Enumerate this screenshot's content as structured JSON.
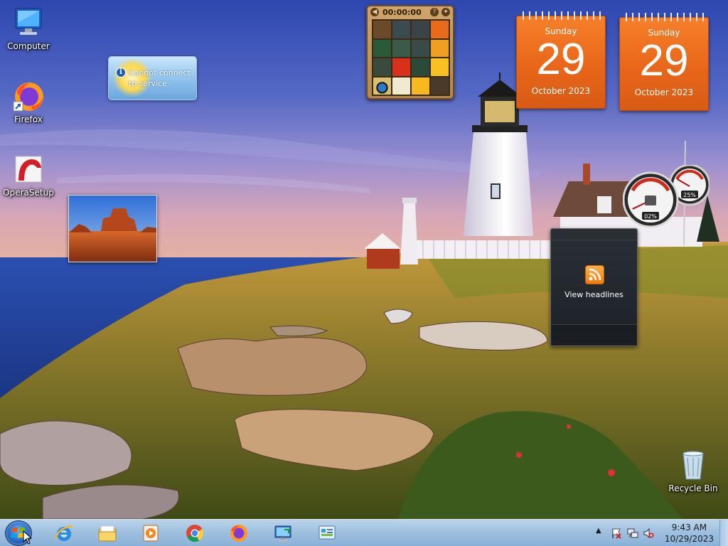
{
  "desktop": {
    "icons": [
      {
        "label": "Computer",
        "icon": "computer-icon"
      },
      {
        "label": "Firefox",
        "icon": "firefox-icon"
      },
      {
        "label": "OperaSetup",
        "icon": "opera-setup-icon"
      },
      {
        "label": "Recycle Bin",
        "icon": "recycle-bin-icon"
      }
    ]
  },
  "gadgets": {
    "weather": {
      "message": "Cannot connect to service",
      "icon": "info-icon"
    },
    "puzzle": {
      "timer": "00:00:00",
      "help_label": "?",
      "icon": "picture-puzzle-icon"
    },
    "calendars": [
      {
        "weekday": "Sunday",
        "day": "29",
        "month_year": "October 2023"
      },
      {
        "weekday": "Sunday",
        "day": "29",
        "month_year": "October 2023"
      }
    ],
    "cpu_meter": {
      "cpu_percent": "02%",
      "memory_percent": "25%",
      "cpu_value": 2,
      "memory_value": 25
    },
    "feed": {
      "label": "View headlines",
      "icon": "rss-icon"
    }
  },
  "taskbar": {
    "apps": [
      {
        "name": "internet-explorer-icon"
      },
      {
        "name": "file-explorer-icon"
      },
      {
        "name": "media-player-icon"
      },
      {
        "name": "chrome-icon"
      },
      {
        "name": "firefox-icon"
      },
      {
        "name": "remote-desktop-icon"
      },
      {
        "name": "control-panel-icon"
      }
    ],
    "tray": {
      "time": "9:43 AM",
      "date": "10/29/2023",
      "icons": [
        "show-hidden-icons-chevron",
        "action-center-flag-icon",
        "network-icon",
        "volume-muted-icon"
      ]
    }
  },
  "colors": {
    "calendar_orange": "#e8661a",
    "taskbar": "#9fc0e0",
    "sky_top": "#3550b8",
    "sea": "#2a4fae"
  }
}
